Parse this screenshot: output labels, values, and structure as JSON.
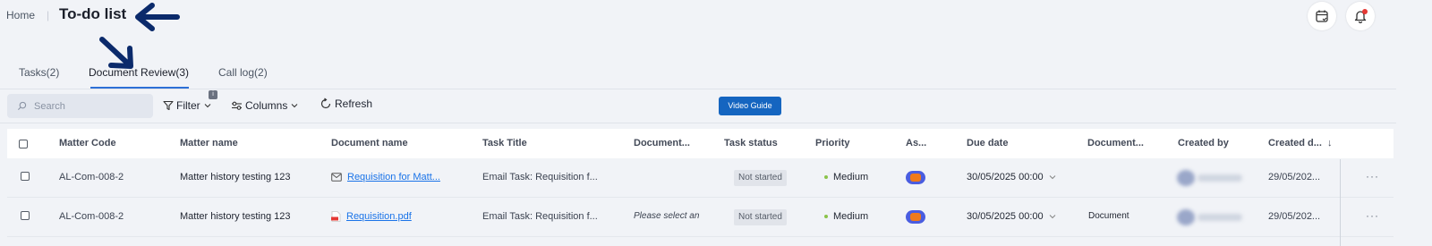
{
  "breadcrumb": {
    "home": "Home",
    "separator": "|"
  },
  "page": {
    "title": "To-do list"
  },
  "header_icons": {
    "calendar": "calendar-check-icon",
    "notifications": "bell-icon"
  },
  "tabs": [
    {
      "label": "Tasks(2)",
      "active": false
    },
    {
      "label": "Document Review(3)",
      "active": true
    },
    {
      "label": "Call log(2)",
      "active": false
    }
  ],
  "toolbar": {
    "search_placeholder": "Search",
    "filter_label": "Filter",
    "filter_badge": "i",
    "columns_label": "Columns",
    "refresh_label": "Refresh",
    "video_guide_label": "Video Guide"
  },
  "table": {
    "columns": [
      "Matter Code",
      "Matter name",
      "Document name",
      "Task Title",
      "Document...",
      "Task status",
      "Priority",
      "As...",
      "Due date",
      "Document...",
      "Created by",
      "Created d..."
    ],
    "sort_indicator": "↓",
    "rows": [
      {
        "matter_code": "AL-Com-008-2",
        "matter_name": "Matter history testing 123",
        "document_name": "Requisition for Matt...",
        "document_icon": "email-icon",
        "task_title": "Email Task: Requisition f...",
        "document_col": "",
        "task_status": "Not started",
        "priority": "Medium",
        "due_date": "30/05/2025 00:00",
        "document_col2": "",
        "created_date": "29/05/202...",
        "more": "···"
      },
      {
        "matter_code": "AL-Com-008-2",
        "matter_name": "Matter history testing 123",
        "document_name": "Requisition.pdf",
        "document_icon": "pdf-file-icon",
        "task_title": "Email Task: Requisition f...",
        "document_col": "Please select an",
        "task_status": "Not started",
        "priority": "Medium",
        "due_date": "30/05/2025 00:00",
        "document_col2": "Document",
        "created_date": "29/05/202...",
        "more": "···"
      }
    ]
  },
  "colors": {
    "accent": "#2c6fd6",
    "button": "#1565c0",
    "link": "#1a73e8",
    "priority_medium": "#8bc34a",
    "annotation_arrow": "#0b2a6b"
  }
}
